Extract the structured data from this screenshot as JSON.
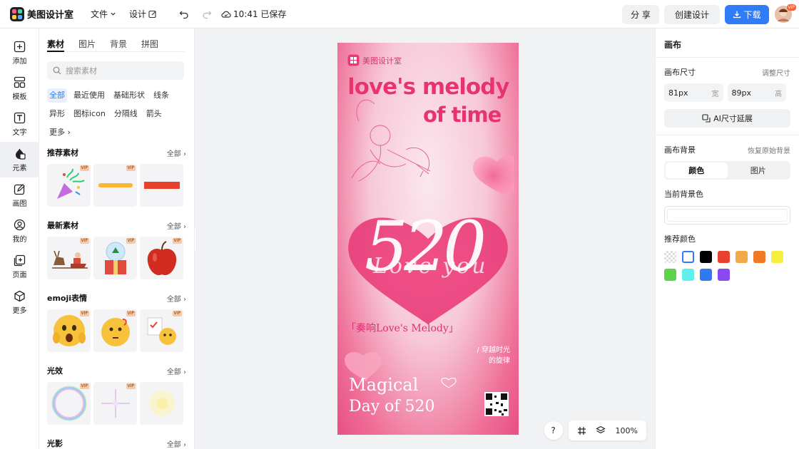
{
  "app": {
    "name": "美图设计室"
  },
  "topbar": {
    "menu_file": "文件",
    "menu_design": "设计",
    "saved_status": "10:41 已保存",
    "share": "分 享",
    "create": "创建设计",
    "download": "下载",
    "avatar_badge": "VIP"
  },
  "nav": [
    {
      "label": "添加",
      "icon": "plus-square-icon"
    },
    {
      "label": "模板",
      "icon": "template-icon"
    },
    {
      "label": "文字",
      "icon": "text-icon"
    },
    {
      "label": "元素",
      "icon": "shapes-icon"
    },
    {
      "label": "画图",
      "icon": "draw-icon"
    },
    {
      "label": "我的",
      "icon": "user-icon"
    },
    {
      "label": "页面",
      "icon": "page-icon"
    },
    {
      "label": "更多",
      "icon": "cube-icon"
    }
  ],
  "panel": {
    "tabs": [
      "素材",
      "图片",
      "背景",
      "拼图"
    ],
    "search_placeholder": "搜索素材",
    "chips": [
      "全部",
      "最近使用",
      "基础形状",
      "线条",
      "异形",
      "图标icon",
      "分隔线",
      "箭头",
      "更多"
    ],
    "all_label": "全部",
    "vip": "VIP",
    "sections": [
      {
        "title": "推荐素材"
      },
      {
        "title": "最新素材"
      },
      {
        "title": "emoji表情"
      },
      {
        "title": "光效"
      },
      {
        "title": "光影"
      }
    ]
  },
  "poster": {
    "brand": "美图设计室",
    "headline1": "love's melody",
    "headline2": "of time",
    "number": "520",
    "script": "Love you",
    "subtitle": "「奏响Love's Melody」",
    "side1": "/ 穿越时光",
    "side2": "的旋律",
    "foot1": "Magical",
    "foot2": "Day of 520"
  },
  "canvas_tools": {
    "help": "?",
    "zoom": "100%"
  },
  "right": {
    "title": "画布",
    "size_label": "画布尺寸",
    "adjust": "调整尺寸",
    "width_value": "81px",
    "width_unit": "宽",
    "height_value": "89px",
    "height_unit": "高",
    "ai_extend": "AI尺寸延展",
    "bg_label": "画布背景",
    "restore": "恢复原始背景",
    "seg_color": "颜色",
    "seg_image": "图片",
    "current_bg": "当前背景色",
    "current_color": "#ffffff",
    "recommended": "推荐颜色",
    "swatches": [
      "transparent",
      "#ffffff",
      "#000000",
      "#e8412c",
      "#f4a84a",
      "#f07a26",
      "#f8ef3c",
      "#5fd14b",
      "#5ef0ec",
      "#2e7af0",
      "#8a49f0"
    ]
  }
}
